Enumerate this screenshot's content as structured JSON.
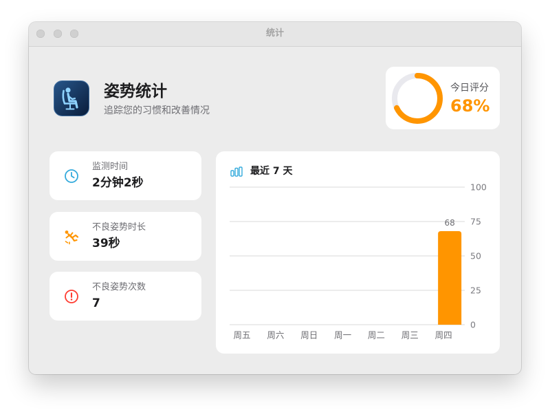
{
  "window": {
    "title": "统计"
  },
  "header": {
    "app_icon": "posture-chair-icon",
    "title": "姿势统计",
    "subtitle": "追踪您的习惯和改善情况"
  },
  "score": {
    "label": "今日评分",
    "value_text": "68%",
    "percent": 68,
    "color": "#FF9500",
    "track_color": "#E9E9EE"
  },
  "stats": [
    {
      "icon": "clock-icon",
      "label": "监测时间",
      "value": "2分钟2秒",
      "color": "#34AADC"
    },
    {
      "icon": "figure-fall-icon",
      "label": "不良姿势时长",
      "value": "39秒",
      "color": "#FF9500"
    },
    {
      "icon": "exclamation-circle-icon",
      "label": "不良姿势次数",
      "value": "7",
      "color": "#FF3B30"
    }
  ],
  "chart_panel": {
    "icon": "bar-chart-icon",
    "icon_color": "#34AADC"
  },
  "chart_data": {
    "type": "bar",
    "title": "最近 7 天",
    "xlabel": "",
    "ylabel": "",
    "categories": [
      "周五",
      "周六",
      "周日",
      "周一",
      "周二",
      "周三",
      "周四"
    ],
    "values": [
      null,
      null,
      null,
      null,
      null,
      null,
      68
    ],
    "data_labels": true,
    "color": "#FF9500",
    "ylim": [
      0,
      100
    ],
    "yticks": [
      0,
      25,
      50,
      75,
      100
    ],
    "y_axis_side": "right",
    "grid": true
  }
}
